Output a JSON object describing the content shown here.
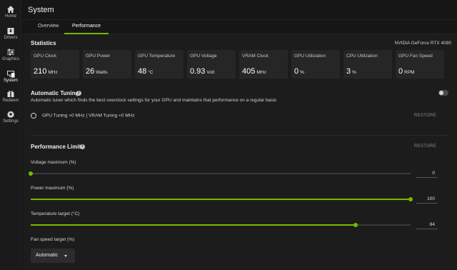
{
  "sidebar": {
    "items": [
      {
        "label": "Home",
        "icon": "home-icon"
      },
      {
        "label": "Drivers",
        "icon": "drivers-icon"
      },
      {
        "label": "Graphics",
        "icon": "graphics-icon"
      },
      {
        "label": "System",
        "icon": "system-icon"
      },
      {
        "label": "Redeem",
        "icon": "redeem-icon"
      },
      {
        "label": "Settings",
        "icon": "settings-icon"
      }
    ],
    "active": "System"
  },
  "header": {
    "title": "System"
  },
  "tabs": [
    {
      "label": "Overview"
    },
    {
      "label": "Performance"
    }
  ],
  "active_tab": "Performance",
  "statistics": {
    "title": "Statistics",
    "gpu_name": "NVIDIA GeForce RTX 4080",
    "cards": [
      {
        "label": "GPU Clock",
        "value": "210",
        "unit": "MHz"
      },
      {
        "label": "GPU Power",
        "value": "26",
        "unit": "Watts"
      },
      {
        "label": "GPU Temperature",
        "value": "48",
        "unit": "°C"
      },
      {
        "label": "GPU Voltage",
        "value": "0.93",
        "unit": "Volt"
      },
      {
        "label": "VRAM Clock",
        "value": "405",
        "unit": "MHz"
      },
      {
        "label": "GPU Utilization",
        "value": "0",
        "unit": "%"
      },
      {
        "label": "CPU Utilization",
        "value": "3",
        "unit": "%"
      },
      {
        "label": "GPU Fan Speed",
        "value": "0",
        "unit": "RPM"
      }
    ]
  },
  "auto_tuning": {
    "title": "Automatic Tuning",
    "description": "Automatic tuner which finds the best overclock settings for your GPU and maintains that performance on a regular basis",
    "enabled": false,
    "status": "GPU Tuning +0 MHz   |   VRAM Tuning +0 MHz",
    "restore_label": "RESTORE"
  },
  "performance_limits": {
    "title": "Performance Limits",
    "restore_label": "RESTORE",
    "sliders": [
      {
        "label": "Voltage maximum (%)",
        "value": "0",
        "fraction": 0.0
      },
      {
        "label": "Power maximum (%)",
        "value": "100",
        "fraction": 1.0
      },
      {
        "label": "Temperature target (°C)",
        "value": "84",
        "fraction": 0.855
      }
    ],
    "fan_speed": {
      "label": "Fan speed target (%)",
      "selected": "Automatic"
    }
  },
  "colors": {
    "accent": "#76b900",
    "background": "#1c1c1c",
    "card": "#262626"
  }
}
